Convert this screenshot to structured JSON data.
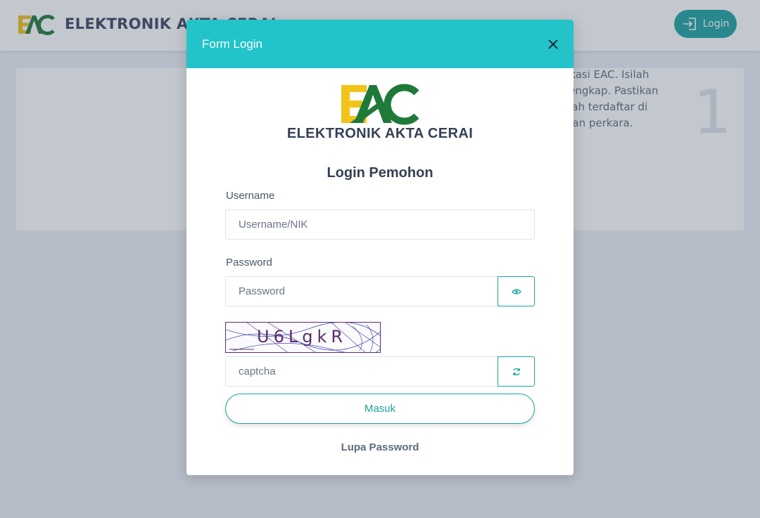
{
  "navbar": {
    "brand_title": "ELEKTRONIK AKTA CERAI",
    "login_label": "Login"
  },
  "background": {
    "paragraph_lines": [
      "ke aplikasi EAC. Isilah",
      "r dan lengkap. Pastikan",
      "ang telah terdaftar di",
      "daftarkan perkara."
    ],
    "step_number": "1"
  },
  "modal": {
    "title": "Form Login",
    "brand_text": "ELEKTRONIK AKTA CERAI",
    "heading": "Login Pemohon",
    "username": {
      "label": "Username",
      "placeholder": "Username/NIK"
    },
    "password": {
      "label": "Password",
      "placeholder": "Password"
    },
    "captcha": {
      "image_text": "U6LgkR",
      "placeholder": "captcha"
    },
    "submit_label": "Masuk",
    "forgot_label": "Lupa Password"
  },
  "colors": {
    "accent": "#22c4c9",
    "primary_button": "#1ba3a0",
    "logo_yellow": "#f2c319",
    "logo_green": "#1f7a3a",
    "text_dark": "#344056"
  }
}
